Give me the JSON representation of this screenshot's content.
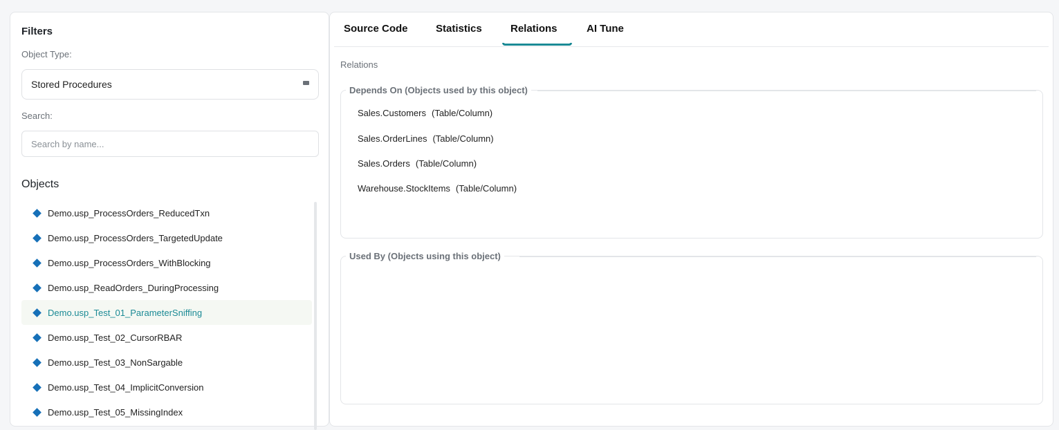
{
  "filters": {
    "title": "Filters",
    "object_type_label": "Object Type:",
    "object_type_value": "Stored Procedures",
    "search_label": "Search:",
    "search_placeholder": "Search by name..."
  },
  "objects": {
    "title": "Objects",
    "items": [
      {
        "label": "Demo.usp_ProcessOrders_ReducedTxn"
      },
      {
        "label": "Demo.usp_ProcessOrders_TargetedUpdate"
      },
      {
        "label": "Demo.usp_ProcessOrders_WithBlocking"
      },
      {
        "label": "Demo.usp_ReadOrders_DuringProcessing"
      },
      {
        "label": "Demo.usp_Test_01_ParameterSniffing",
        "active": true
      },
      {
        "label": "Demo.usp_Test_02_CursorRBAR"
      },
      {
        "label": "Demo.usp_Test_03_NonSargable"
      },
      {
        "label": "Demo.usp_Test_04_ImplicitConversion"
      },
      {
        "label": "Demo.usp_Test_05_MissingIndex"
      }
    ]
  },
  "tabs": [
    {
      "label": "Source Code"
    },
    {
      "label": "Statistics"
    },
    {
      "label": "Relations",
      "active": true
    },
    {
      "label": "AI Tune"
    }
  ],
  "relations": {
    "caption": "Relations",
    "depends_on": {
      "legend": "Depends On (Objects used by this object)",
      "items": [
        {
          "name": "Sales.Customers",
          "kind": "(Table/Column)"
        },
        {
          "name": "Sales.OrderLines",
          "kind": "(Table/Column)"
        },
        {
          "name": "Sales.Orders",
          "kind": "(Table/Column)"
        },
        {
          "name": "Warehouse.StockItems",
          "kind": "(Table/Column)"
        }
      ]
    },
    "used_by": {
      "legend": "Used By (Objects using this object)",
      "items": []
    }
  },
  "colors": {
    "accent": "#1b8a95",
    "diamond": "#1670b8"
  }
}
